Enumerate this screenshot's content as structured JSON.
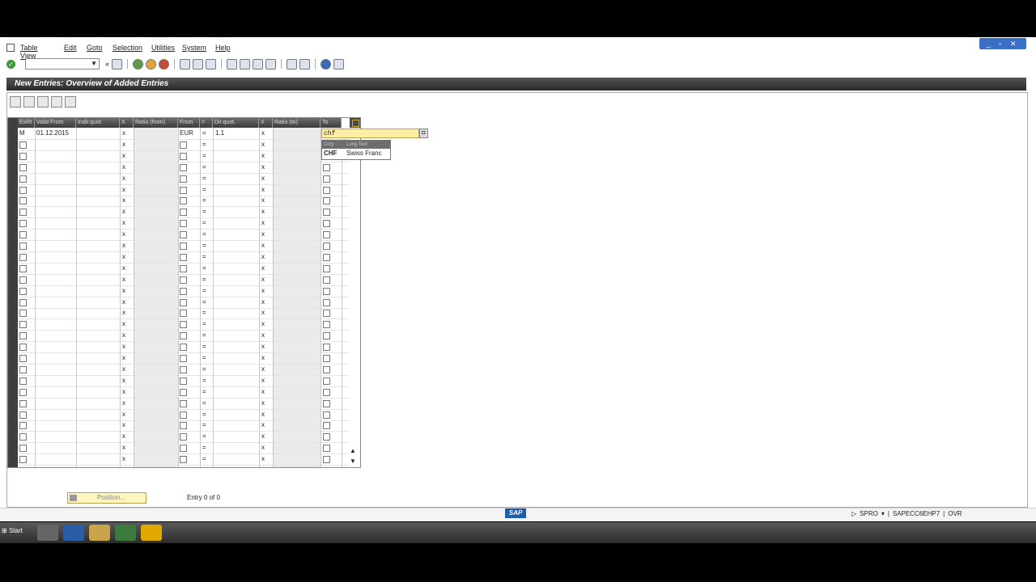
{
  "window": {
    "controls": "_ ▫ ✕"
  },
  "menu": [
    "Table View",
    "Edit",
    "Goto",
    "Selection",
    "Utilities",
    "System",
    "Help"
  ],
  "page": {
    "title": "New Entries: Overview of Added Entries"
  },
  "table": {
    "columns": [
      "ExRt",
      "Valid From",
      "Indir.quot",
      "X",
      "Ratio (from)",
      "From",
      "=",
      "Dir.quot.",
      "X",
      "Ratio (to)",
      "To"
    ],
    "first_row": {
      "type": "M",
      "valid_from": "01.12.2015",
      "x1": "x",
      "from": "EUR",
      "eq": "=",
      "dir_quot": "1.1",
      "x2": "x"
    },
    "row_x": "x",
    "row_eq": "="
  },
  "f4": {
    "input_value": "chf",
    "header": [
      "Crcy",
      "Long Text"
    ],
    "code": "CHF",
    "text": "Swiss Franc"
  },
  "bottom": {
    "position_label": "Position...",
    "entry_text": "Entry 0 of 0"
  },
  "status": {
    "sap_logo": "SAP",
    "transaction": "SPRO",
    "server": "SAPECC6EHP7",
    "mode": "OVR"
  },
  "taskbar": {
    "start_label": "Start"
  }
}
